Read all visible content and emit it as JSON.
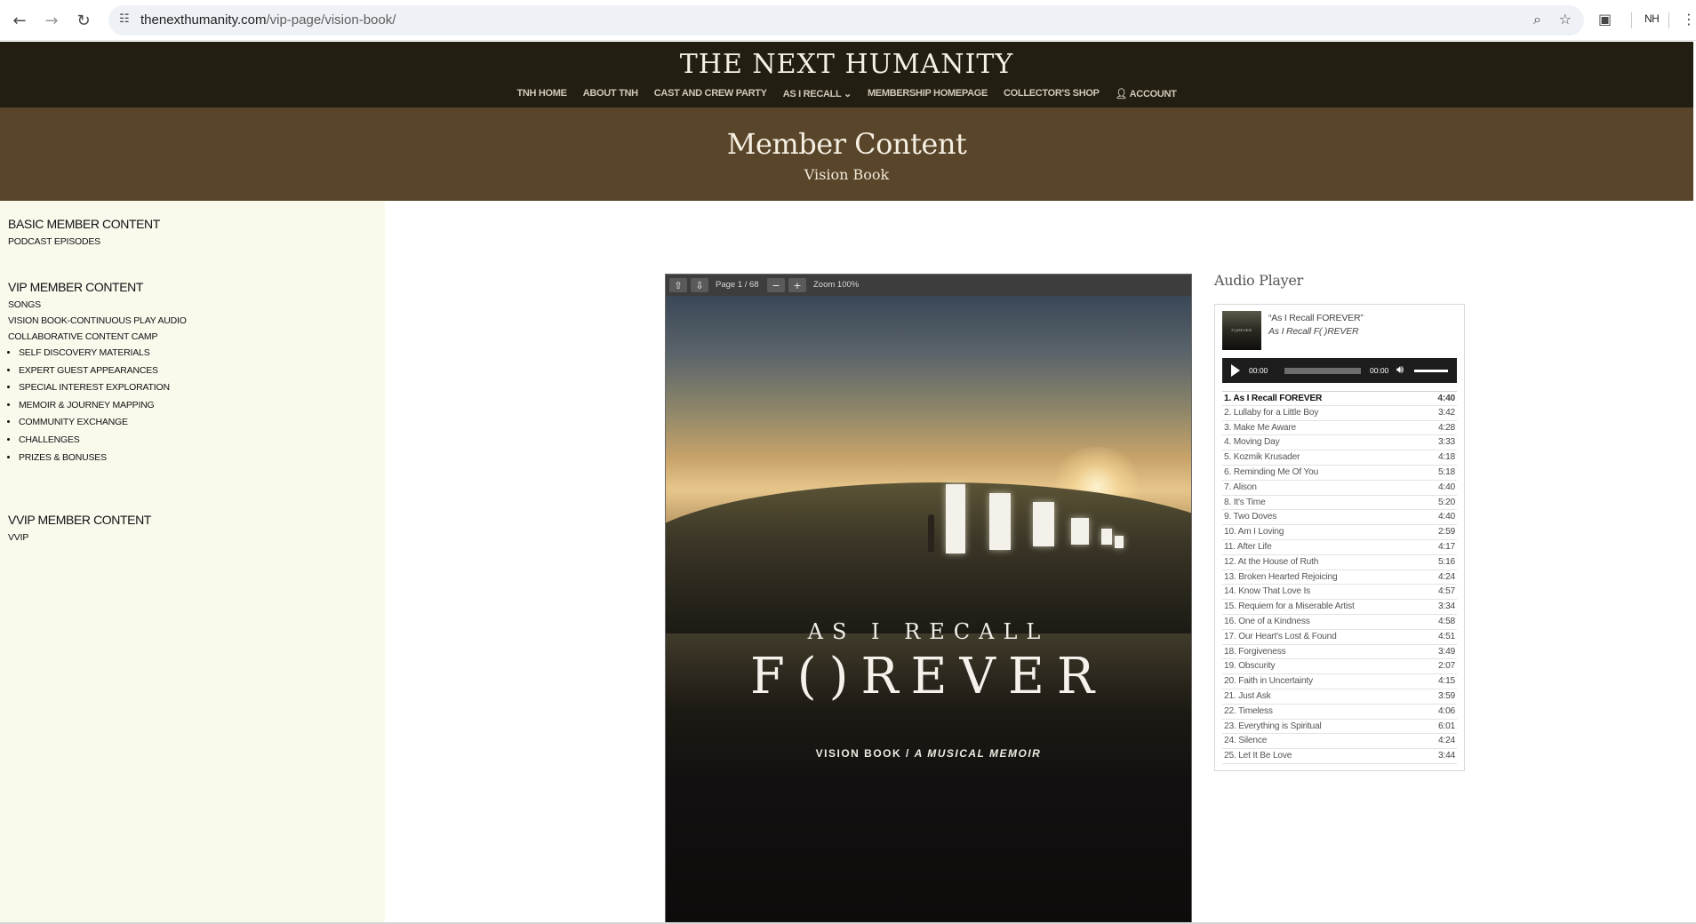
{
  "browser": {
    "url_domain": "thenexthumanity.com",
    "url_path": "/vip-page/vision-book/",
    "profile": "NH",
    "icons": [
      "back-icon",
      "forward-icon",
      "reload-icon",
      "site-info-icon",
      "zoom-icon",
      "star-icon",
      "reading-list-icon",
      "menu-icon"
    ]
  },
  "site": {
    "logo": "THE NEXT HUMANITY",
    "menu": [
      "TNH HOME",
      "ABOUT TNH",
      "CAST AND CREW PARTY",
      "AS I RECALL ⌄",
      "MEMBERSHIP HOMEPAGE",
      "COLLECTOR'S SHOP",
      "ACCOUNT"
    ],
    "colors": {
      "header": "#231e12",
      "hero": "#59452a",
      "sidebar": "#fbf8ec"
    }
  },
  "hero": {
    "title": "Member Content",
    "subtitle": "Vision Book"
  },
  "sidebar": {
    "basic_heading": "BASIC MEMBER CONTENT",
    "basic_links": [
      "PODCAST EPISODES"
    ],
    "vip_heading": "VIP MEMBER CONTENT",
    "vip_links": [
      "SONGS",
      "VISION BOOK-CONTINUOUS PLAY AUDIO",
      "COLLABORATIVE CONTENT CAMP"
    ],
    "vip_bullets": [
      "SELF DISCOVERY MATERIALS",
      "EXPERT GUEST APPEARANCES",
      "SPECIAL INTEREST EXPLORATION",
      "MEMOIR & JOURNEY MAPPING",
      "COMMUNITY EXCHANGE",
      "CHALLENGES",
      "PRIZES & BONUSES"
    ],
    "vvip_heading": "VVIP MEMBER CONTENT",
    "vvip_links": [
      "VVIP"
    ]
  },
  "viewer": {
    "page_label": "Page 1 / 68",
    "zoom_label": "Zoom 100%",
    "cover_pre": "AS  I  RECALL",
    "cover_title": "F()REVER",
    "cover_sub_a": "VISION BOOK",
    "cover_sub_sep": " / ",
    "cover_sub_b": "A MUSICAL MEMOIR"
  },
  "audio_player": {
    "heading": "Audio Player",
    "song": "“As I Recall FOREVER”",
    "album": "As I Recall F( )REVER",
    "time_current": "00:00",
    "time_total": "00:00",
    "tracks": [
      {
        "title": "1. As I Recall FOREVER",
        "dur": "4:40"
      },
      {
        "title": "2. Lullaby for a Little Boy",
        "dur": "3:42"
      },
      {
        "title": "3. Make Me Aware",
        "dur": "4:28"
      },
      {
        "title": "4. Moving Day",
        "dur": "3:33"
      },
      {
        "title": "5. Kozmik Krusader",
        "dur": "4:18"
      },
      {
        "title": "6. Reminding Me Of You",
        "dur": "5:18"
      },
      {
        "title": "7. Alison",
        "dur": "4:40"
      },
      {
        "title": "8. It's Time",
        "dur": "5:20"
      },
      {
        "title": "9. Two Doves",
        "dur": "4:40"
      },
      {
        "title": "10. Am I Loving",
        "dur": "2:59"
      },
      {
        "title": "11. After Life",
        "dur": "4:17"
      },
      {
        "title": "12. At the House of Ruth",
        "dur": "5:16"
      },
      {
        "title": "13. Broken Hearted Rejoicing",
        "dur": "4:24"
      },
      {
        "title": "14. Know That Love Is",
        "dur": "4:57"
      },
      {
        "title": "15. Requiem for a Miserable Artist",
        "dur": "3:34"
      },
      {
        "title": "16. One of a Kindness",
        "dur": "4:58"
      },
      {
        "title": "17. Our Heart's Lost & Found",
        "dur": "4:51"
      },
      {
        "title": "18. Forgiveness",
        "dur": "3:49"
      },
      {
        "title": "19. Obscurity",
        "dur": "2:07"
      },
      {
        "title": "20. Faith in Uncertainty",
        "dur": "4:15"
      },
      {
        "title": "21. Just Ask",
        "dur": "3:59"
      },
      {
        "title": "22. Timeless",
        "dur": "4:06"
      },
      {
        "title": "23. Everything is Spiritual",
        "dur": "6:01"
      },
      {
        "title": "24. Silence",
        "dur": "4:24"
      },
      {
        "title": "25. Let It Be Love",
        "dur": "3:44"
      }
    ]
  }
}
